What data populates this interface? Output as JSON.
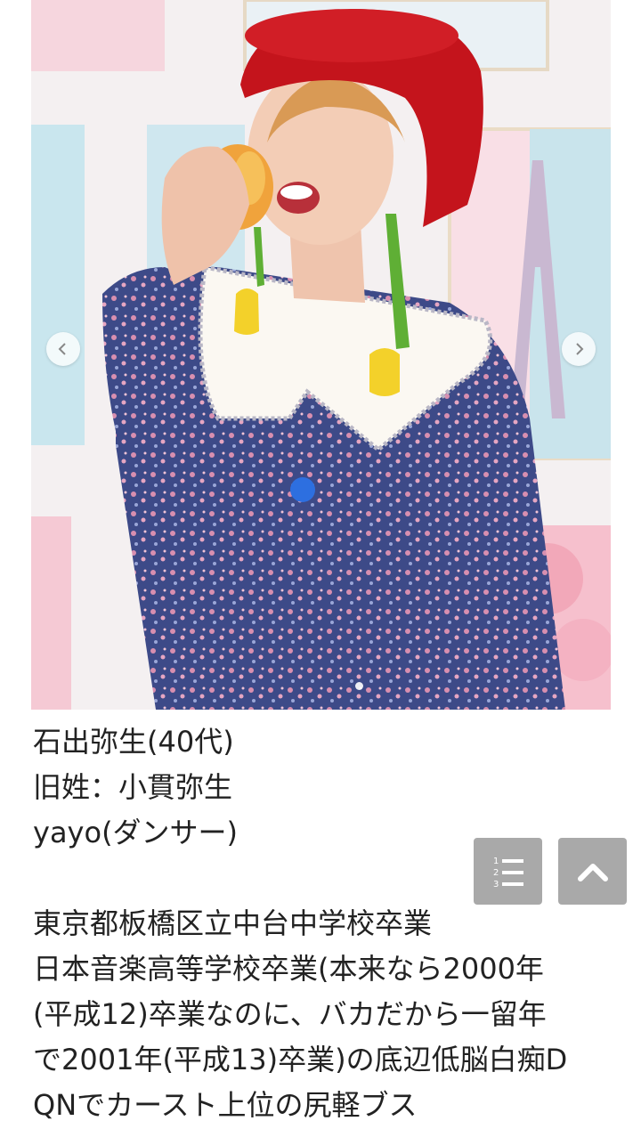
{
  "carousel": {
    "prev_icon": "chevron-left-icon",
    "next_icon": "chevron-right-icon",
    "photo_alt": "Photo of a woman in a red hat and floral dress biting an apple",
    "current_slide": 1
  },
  "profile": {
    "lines": [
      "石出弥生(40代)",
      "旧姓：小貫弥生",
      "yayo(ダンサー)"
    ],
    "details": [
      "東京都板橋区立中台中学校卒業",
      "日本音楽高等学校卒業(本来なら2000年",
      "(平成12)卒業なのに、バカだから一留年",
      "で2001年(平成13)卒業)の底辺低脳白痴D",
      "QNでカースト上位の尻軽ブス"
    ]
  },
  "buttons": {
    "toc_icon": "numbered-list-icon",
    "top_icon": "chevron-up-icon"
  },
  "colors": {
    "fab_bg": "#a9a9a9",
    "hat_red": "#c4141c",
    "dress_navy": "#3a4886"
  }
}
